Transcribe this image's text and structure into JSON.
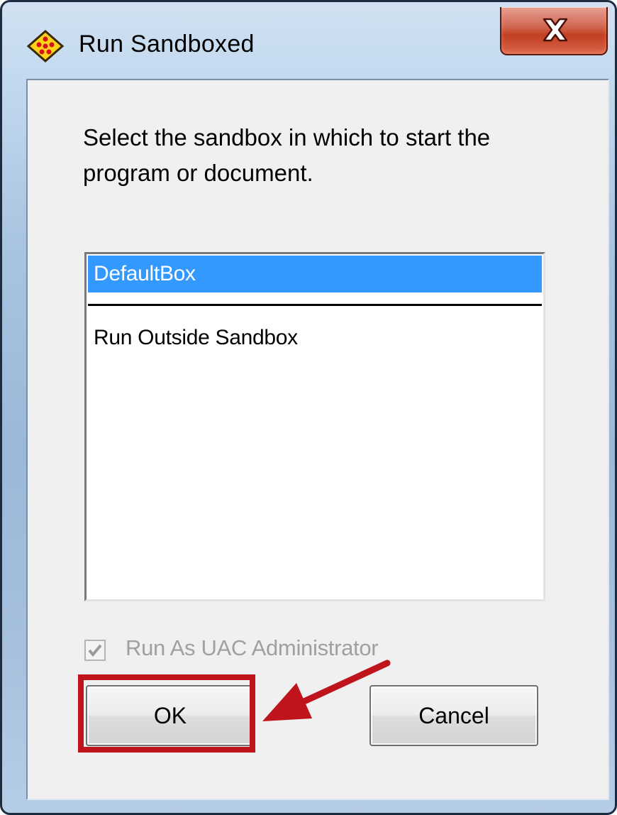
{
  "window": {
    "title": "Run Sandboxed",
    "app_icon": "sandboxie-icon",
    "close_icon": "close-icon"
  },
  "dialog": {
    "prompt": "Select the sandbox in which to start the\nprogram or document.",
    "sandbox_list": {
      "items": [
        {
          "label": "DefaultBox",
          "selected": true
        },
        {
          "label": "Run Outside Sandbox",
          "selected": false
        }
      ]
    },
    "uac_checkbox": {
      "label": "Run As UAC Administrator",
      "checked": true,
      "enabled": false
    },
    "ok_label": "OK",
    "cancel_label": "Cancel"
  },
  "annotation": {
    "highlight_color": "#c0141c",
    "arrow_icon": "red-arrow-icon"
  },
  "colors": {
    "selection": "#3399ff",
    "close_button": "#c23f22",
    "frame": "#a9c4e0"
  }
}
